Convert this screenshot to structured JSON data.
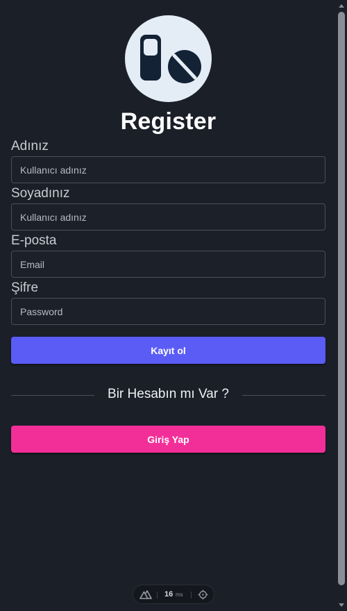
{
  "page": {
    "title": "Register"
  },
  "form": {
    "first_name": {
      "label": "Adınız",
      "placeholder": "Kullanıcı adınız"
    },
    "last_name": {
      "label": "Soyadınız",
      "placeholder": "Kullanıcı adınız"
    },
    "email": {
      "label": "E-posta",
      "placeholder": "Email"
    },
    "password": {
      "label": "Şifre",
      "placeholder": "Password"
    },
    "submit_label": "Kayıt ol"
  },
  "divider": {
    "text": "Bir Hesabın mı Var ?"
  },
  "login_button_label": "Giriş Yap",
  "devtools": {
    "render_time_value": "16",
    "render_time_unit": "ms",
    "icons": [
      "nuxt-logo-icon",
      "crosshair-icon"
    ]
  },
  "colors": {
    "background": "#1b1f28",
    "primary_button": "#5b5cf6",
    "secondary_button": "#f22f98",
    "logo_circle": "#e4ecf6",
    "logo_glyph": "#132235"
  },
  "logo": {
    "icon": "medicine-pills-icon"
  }
}
